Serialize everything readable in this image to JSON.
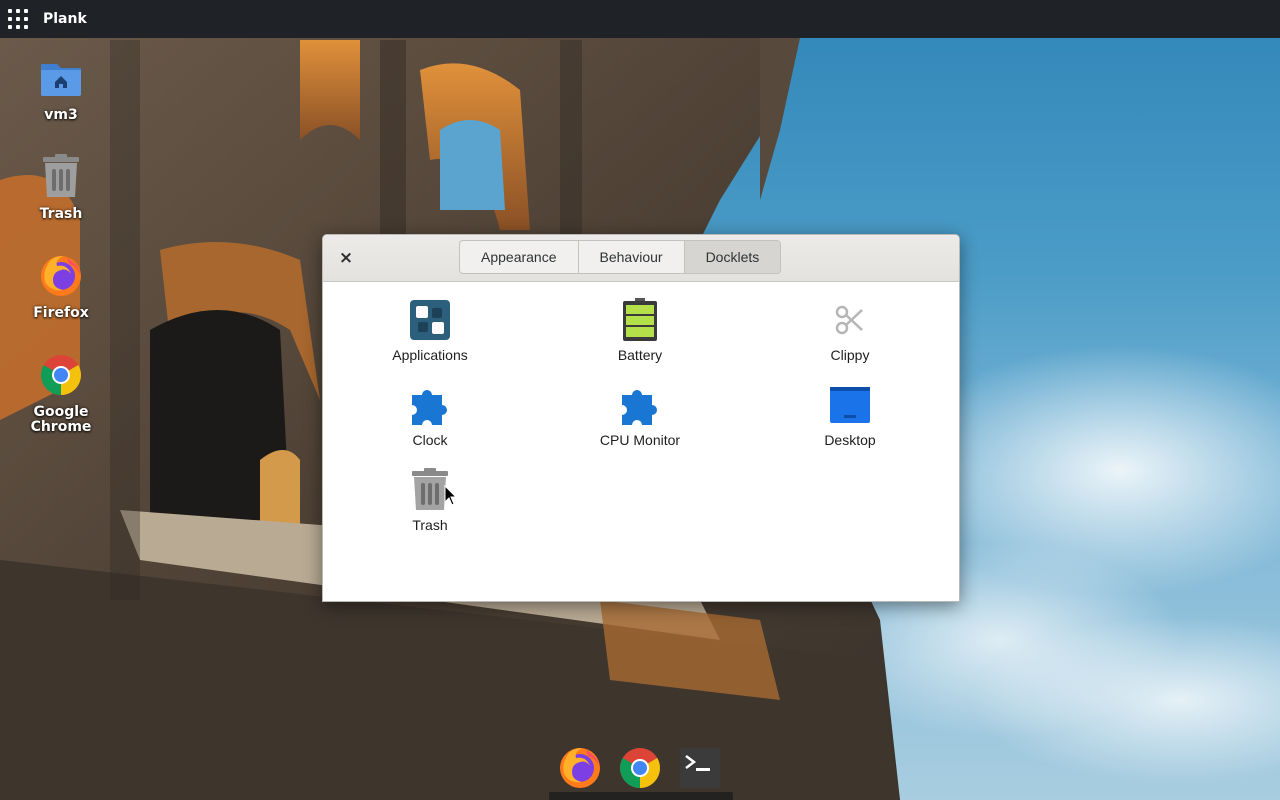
{
  "panel": {
    "app_title": "Plank",
    "apps_icon": "app-grid-icon"
  },
  "desktop_icons": [
    {
      "label": "vm3",
      "icon": "home-folder-icon"
    },
    {
      "label": "Trash",
      "icon": "trash-icon"
    },
    {
      "label": "Firefox",
      "icon": "firefox-icon"
    },
    {
      "label": "Google Chrome",
      "icon": "chrome-icon"
    }
  ],
  "dialog": {
    "close_label": "×",
    "tabs": [
      {
        "label": "Appearance",
        "active": false
      },
      {
        "label": "Behaviour",
        "active": false
      },
      {
        "label": "Docklets",
        "active": true
      }
    ],
    "docklets": [
      {
        "label": "Applications",
        "icon": "applications-icon"
      },
      {
        "label": "Battery",
        "icon": "battery-icon"
      },
      {
        "label": "Clippy",
        "icon": "scissors-icon"
      },
      {
        "label": "Clock",
        "icon": "puzzle-icon"
      },
      {
        "label": "CPU Monitor",
        "icon": "puzzle-icon"
      },
      {
        "label": "Desktop",
        "icon": "desktop-icon"
      },
      {
        "label": "Trash",
        "icon": "trash-icon"
      }
    ]
  },
  "dock": {
    "items": [
      {
        "name": "Firefox",
        "icon": "firefox-icon"
      },
      {
        "name": "Google Chrome",
        "icon": "chrome-icon"
      },
      {
        "name": "Terminal",
        "icon": "terminal-icon"
      }
    ]
  },
  "colors": {
    "panel_bg": "#1f2328",
    "accent_blue": "#1a73e8",
    "battery_green": "#b4e04a"
  }
}
